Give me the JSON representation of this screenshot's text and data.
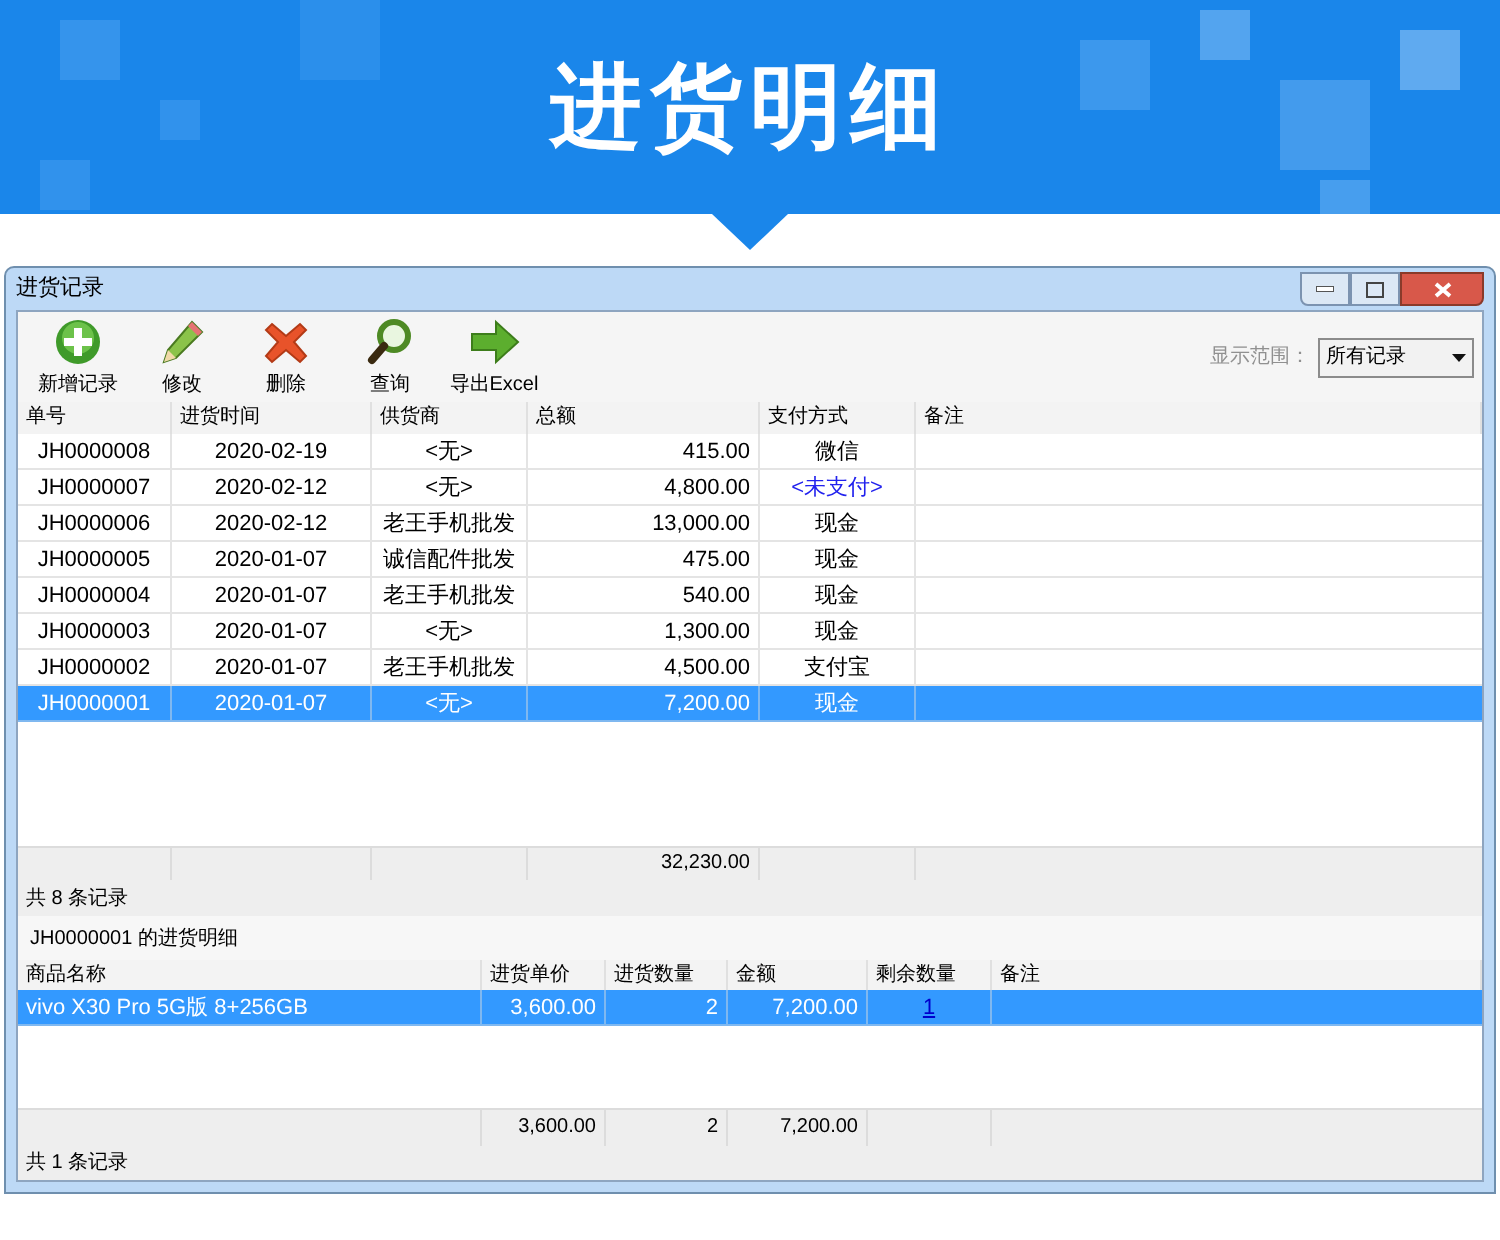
{
  "banner": {
    "title": "进货明细"
  },
  "window": {
    "title": "进货记录"
  },
  "toolbar": [
    {
      "kind": "add",
      "label": "新增记录"
    },
    {
      "kind": "edit",
      "label": "修改"
    },
    {
      "kind": "delete",
      "label": "删除"
    },
    {
      "kind": "search",
      "label": "查询"
    },
    {
      "kind": "export",
      "label": "导出Excel"
    }
  ],
  "filter": {
    "label": "显示范围：",
    "value": "所有记录"
  },
  "table": {
    "columns": [
      "单号",
      "进货时间",
      "供货商",
      "总额",
      "支付方式",
      "备注"
    ],
    "rows": [
      {
        "id": "JH0000008",
        "date": "2020-02-19",
        "supplier": "<无>",
        "amount": "415.00",
        "payment": "微信",
        "paid": true,
        "selected": false
      },
      {
        "id": "JH0000007",
        "date": "2020-02-12",
        "supplier": "<无>",
        "amount": "4,800.00",
        "payment": "<未支付>",
        "paid": false,
        "selected": false
      },
      {
        "id": "JH0000006",
        "date": "2020-02-12",
        "supplier": "老王手机批发",
        "amount": "13,000.00",
        "payment": "现金",
        "paid": true,
        "selected": false
      },
      {
        "id": "JH0000005",
        "date": "2020-01-07",
        "supplier": "诚信配件批发",
        "amount": "475.00",
        "payment": "现金",
        "paid": true,
        "selected": false
      },
      {
        "id": "JH0000004",
        "date": "2020-01-07",
        "supplier": "老王手机批发",
        "amount": "540.00",
        "payment": "现金",
        "paid": true,
        "selected": false
      },
      {
        "id": "JH0000003",
        "date": "2020-01-07",
        "supplier": "<无>",
        "amount": "1,300.00",
        "payment": "现金",
        "paid": true,
        "selected": false
      },
      {
        "id": "JH0000002",
        "date": "2020-01-07",
        "supplier": "老王手机批发",
        "amount": "4,500.00",
        "payment": "支付宝",
        "paid": true,
        "selected": false
      },
      {
        "id": "JH0000001",
        "date": "2020-01-07",
        "supplier": "<无>",
        "amount": "7,200.00",
        "payment": "现金",
        "paid": true,
        "selected": true
      }
    ],
    "total_amount": "32,230.00",
    "count": "共 8 条记录"
  },
  "detail": {
    "title": "JH0000001 的进货明细",
    "columns": [
      "商品名称",
      "进货单价",
      "进货数量",
      "金额",
      "剩余数量",
      "备注"
    ],
    "rows": [
      {
        "name": "vivo X30 Pro 5G版 8+256GB",
        "price": "3,600.00",
        "quantity": "2",
        "amount": "7,200.00",
        "remaining": "1",
        "selected": true
      }
    ],
    "totals": {
      "price": "3,600.00",
      "quantity": "2",
      "amount": "7,200.00"
    },
    "count": "共 1 条记录"
  }
}
